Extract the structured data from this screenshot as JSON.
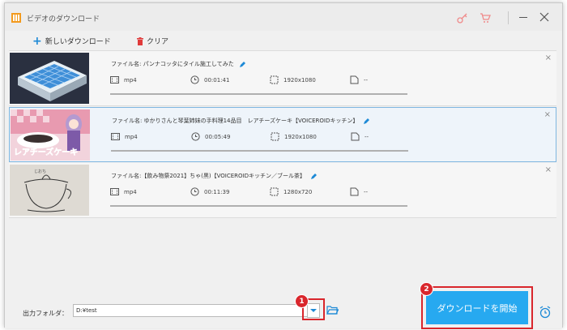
{
  "window": {
    "title": "ビデオのダウンロード"
  },
  "toolbar": {
    "new_download_label": "新しいダウンロード",
    "clear_label": "クリア"
  },
  "items": [
    {
      "filename": "ファイル名: パンナコッタにタイル施工してみた",
      "format": "mp4",
      "duration": "00:01:41",
      "resolution": "1920x1080",
      "size": "--"
    },
    {
      "filename": "ファイル名: ゆかりさんと琴葉姉妹の手料理14品目　レアチーズケーキ【VOICEROIDキッチン】",
      "format": "mp4",
      "duration": "00:05:49",
      "resolution": "1920x1080",
      "size": "--",
      "thumb_text": "レアチーズケーキ"
    },
    {
      "filename": "ファイル名:【飲み物祭2021】ちゃ(黒)【VOICEROIDキッチン／ブール茶】",
      "format": "mp4",
      "duration": "00:11:39",
      "resolution": "1280x720",
      "size": "--"
    }
  ],
  "output": {
    "label": "出力フォルダ：",
    "path": "D:¥test"
  },
  "start_button_label": "ダウンロードを開始",
  "annotations": {
    "badge1": "1",
    "badge2": "2"
  },
  "colors": {
    "accent": "#27a9f0",
    "highlight": "#d9262c",
    "icon_blue": "#1e8ad6",
    "clear_red": "#e03a3a"
  }
}
